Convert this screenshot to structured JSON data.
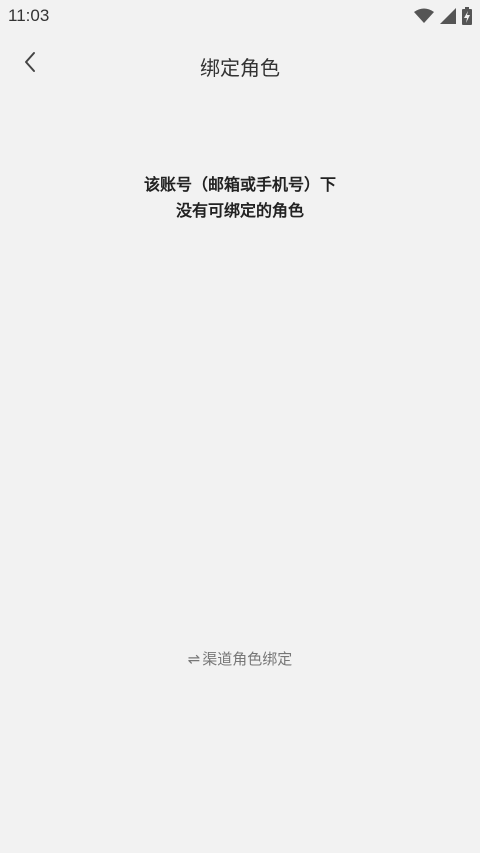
{
  "status_bar": {
    "time": "11:03",
    "icons": [
      "wifi-icon",
      "signal-icon",
      "battery-icon"
    ]
  },
  "header": {
    "back_icon": "chevron-left-icon",
    "title": "绑定角色"
  },
  "main": {
    "message_line1": "该账号（邮箱或手机号）下",
    "message_line2": "没有可绑定的角色"
  },
  "footer": {
    "swap_icon_glyph": "⇌",
    "channel_bind_label": "渠道角色绑定"
  },
  "colors": {
    "background": "#f2f2f2",
    "text_primary": "#222222",
    "text_secondary": "#777777"
  }
}
